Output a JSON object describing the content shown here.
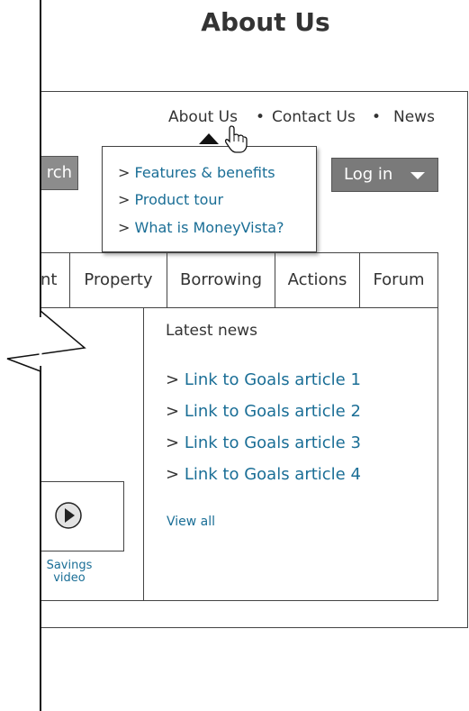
{
  "page": {
    "title": "About Us"
  },
  "top_nav": {
    "items": [
      {
        "label": "About Us"
      },
      {
        "label": "Contact Us"
      },
      {
        "label": "News"
      }
    ],
    "separator": "•"
  },
  "search": {
    "button_label": "rch"
  },
  "login": {
    "label": "Log in"
  },
  "dropdown": {
    "items": [
      {
        "prefix": ">",
        "label": "Features & benefits"
      },
      {
        "prefix": ">",
        "label": "Product tour"
      },
      {
        "prefix": ">",
        "label": "What is MoneyVista?"
      }
    ]
  },
  "tabs": [
    {
      "label": "nt"
    },
    {
      "label": "Property"
    },
    {
      "label": "Borrowing"
    },
    {
      "label": "Actions"
    },
    {
      "label": "Forum"
    }
  ],
  "news": {
    "heading": "Latest news",
    "items": [
      {
        "prefix": ">",
        "label": "Link to Goals article 1"
      },
      {
        "prefix": ">",
        "label": "Link to Goals article 2"
      },
      {
        "prefix": ">",
        "label": "Link to Goals article 3"
      },
      {
        "prefix": ">",
        "label": "Link to Goals article 4"
      }
    ],
    "view_all": "View all"
  },
  "video": {
    "label_line1": "Savings",
    "label_line2": "video"
  },
  "colors": {
    "link": "#1a6e96",
    "button_gray": "#7a7a7a",
    "border": "#444444"
  }
}
